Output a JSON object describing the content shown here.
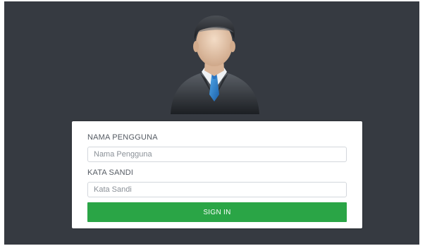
{
  "login": {
    "username": {
      "label": "NAMA PENGGUNA",
      "placeholder": "Nama Pengguna",
      "value": ""
    },
    "password": {
      "label": "KATA SANDI",
      "placeholder": "Kata Sandi",
      "value": ""
    },
    "submit_label": "SIGN IN"
  },
  "icons": {
    "avatar": "businessman-user-avatar-icon"
  },
  "colors": {
    "background": "#363a41",
    "card": "#ffffff",
    "button": "#2aa546",
    "label_text": "#555b63"
  }
}
